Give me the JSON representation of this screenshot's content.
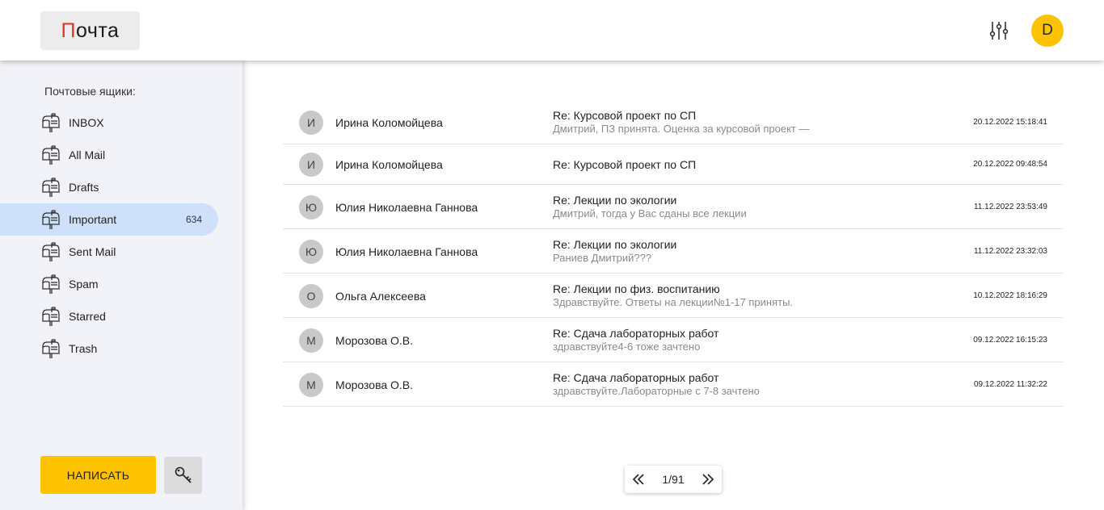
{
  "header": {
    "logo_first": "П",
    "logo_rest": "очта",
    "settings_icon": "sliders-icon",
    "user_initial": "D",
    "avatar_color": "#fdc300"
  },
  "sidebar": {
    "title": "Почтовые ящики:",
    "mailboxes": [
      {
        "label": "INBOX",
        "count": "",
        "active": false,
        "icon": "mailbox-icon"
      },
      {
        "label": "All Mail",
        "count": "",
        "active": false,
        "icon": "mailbox-icon"
      },
      {
        "label": "Drafts",
        "count": "",
        "active": false,
        "icon": "mailbox-icon"
      },
      {
        "label": "Important",
        "count": "634",
        "active": true,
        "icon": "mailbox-icon"
      },
      {
        "label": "Sent Mail",
        "count": "",
        "active": false,
        "icon": "mailbox-icon"
      },
      {
        "label": "Spam",
        "count": "",
        "active": false,
        "icon": "mailbox-icon"
      },
      {
        "label": "Starred",
        "count": "",
        "active": false,
        "icon": "mailbox-icon"
      },
      {
        "label": "Trash",
        "count": "",
        "active": false,
        "icon": "mailbox-icon"
      }
    ],
    "compose_label": "НАПИСАТЬ",
    "key_icon": "key-icon",
    "accent_color": "#fdc300",
    "active_color": "#cfe0fb"
  },
  "mails": [
    {
      "initial": "И",
      "sender": "Ирина Коломойцева",
      "subject": "Re: Курсовой проект по СП",
      "preview": "Дмитрий, ПЗ принята. Оценка за курсовой проект —",
      "date": "20.12.2022 15:18:41"
    },
    {
      "initial": "И",
      "sender": "Ирина Коломойцева",
      "subject": "Re: Курсовой проект по СП",
      "preview": "",
      "date": "20.12.2022 09:48:54"
    },
    {
      "initial": "Ю",
      "sender": "Юлия Николаевна Ганнова",
      "subject": "Re: Лекции по экологии",
      "preview": "Дмитрий, тогда у Вас сданы все лекции",
      "date": "11.12.2022 23:53:49"
    },
    {
      "initial": "Ю",
      "sender": "Юлия Николаевна Ганнова",
      "subject": "Re: Лекции по экологии",
      "preview": "Раниев Дмитрий???",
      "date": "11.12.2022 23:32:03"
    },
    {
      "initial": "О",
      "sender": "Ольга Алексеева",
      "subject": "Re: Лекции по физ. воспитанию",
      "preview": "Здравствуйте. Ответы на лекции№1-17 приняты.",
      "date": "10.12.2022 18:16:29"
    },
    {
      "initial": "М",
      "sender": "Морозова О.В.",
      "subject": "Re: Сдача лабораторных работ",
      "preview": "здравствуйте4-6 тоже зачтено",
      "date": "09.12.2022 16:15:23"
    },
    {
      "initial": "М",
      "sender": "Морозова О.В.",
      "subject": "Re: Сдача лабораторных работ",
      "preview": "здравствуйте.Лабораторные с 7-8 зачтено",
      "date": "09.12.2022 11:32:22"
    }
  ],
  "pager": {
    "current": "1",
    "total": "91",
    "text": "1/91",
    "prev_icon": "double-chevron-left-icon",
    "next_icon": "double-chevron-right-icon"
  }
}
